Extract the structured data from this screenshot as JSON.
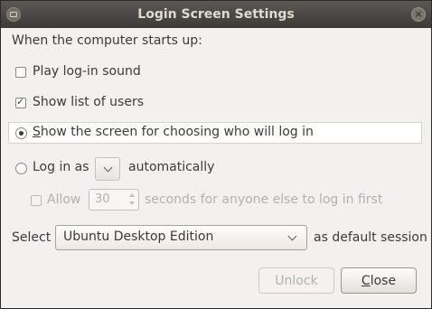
{
  "window": {
    "title": "Login Screen Settings"
  },
  "form": {
    "intro": "When the computer starts up:",
    "play_sound": {
      "label_prefix": "",
      "label_u": "",
      "label": "Play log-in sound",
      "checked": false
    },
    "show_users": {
      "label": "Show list of users",
      "checked": true
    },
    "option_show_screen": {
      "label_u": "S",
      "label_rest": "how the screen for choosing who will log in",
      "selected": true
    },
    "option_login_as": {
      "label": "Log in as",
      "suffix": "automatically",
      "selected": false
    },
    "allow": {
      "label": "Allow",
      "value": "30",
      "suffix": "seconds for anyone else to log in first",
      "checked": false,
      "enabled": false
    },
    "session": {
      "prefix": "Select",
      "value": "Ubuntu Desktop Edition",
      "suffix": "as default session"
    }
  },
  "buttons": {
    "unlock": "Unlock",
    "close_u": "C",
    "close_rest": "lose"
  },
  "icons": {
    "window": "app-icon",
    "close": "close-icon"
  }
}
